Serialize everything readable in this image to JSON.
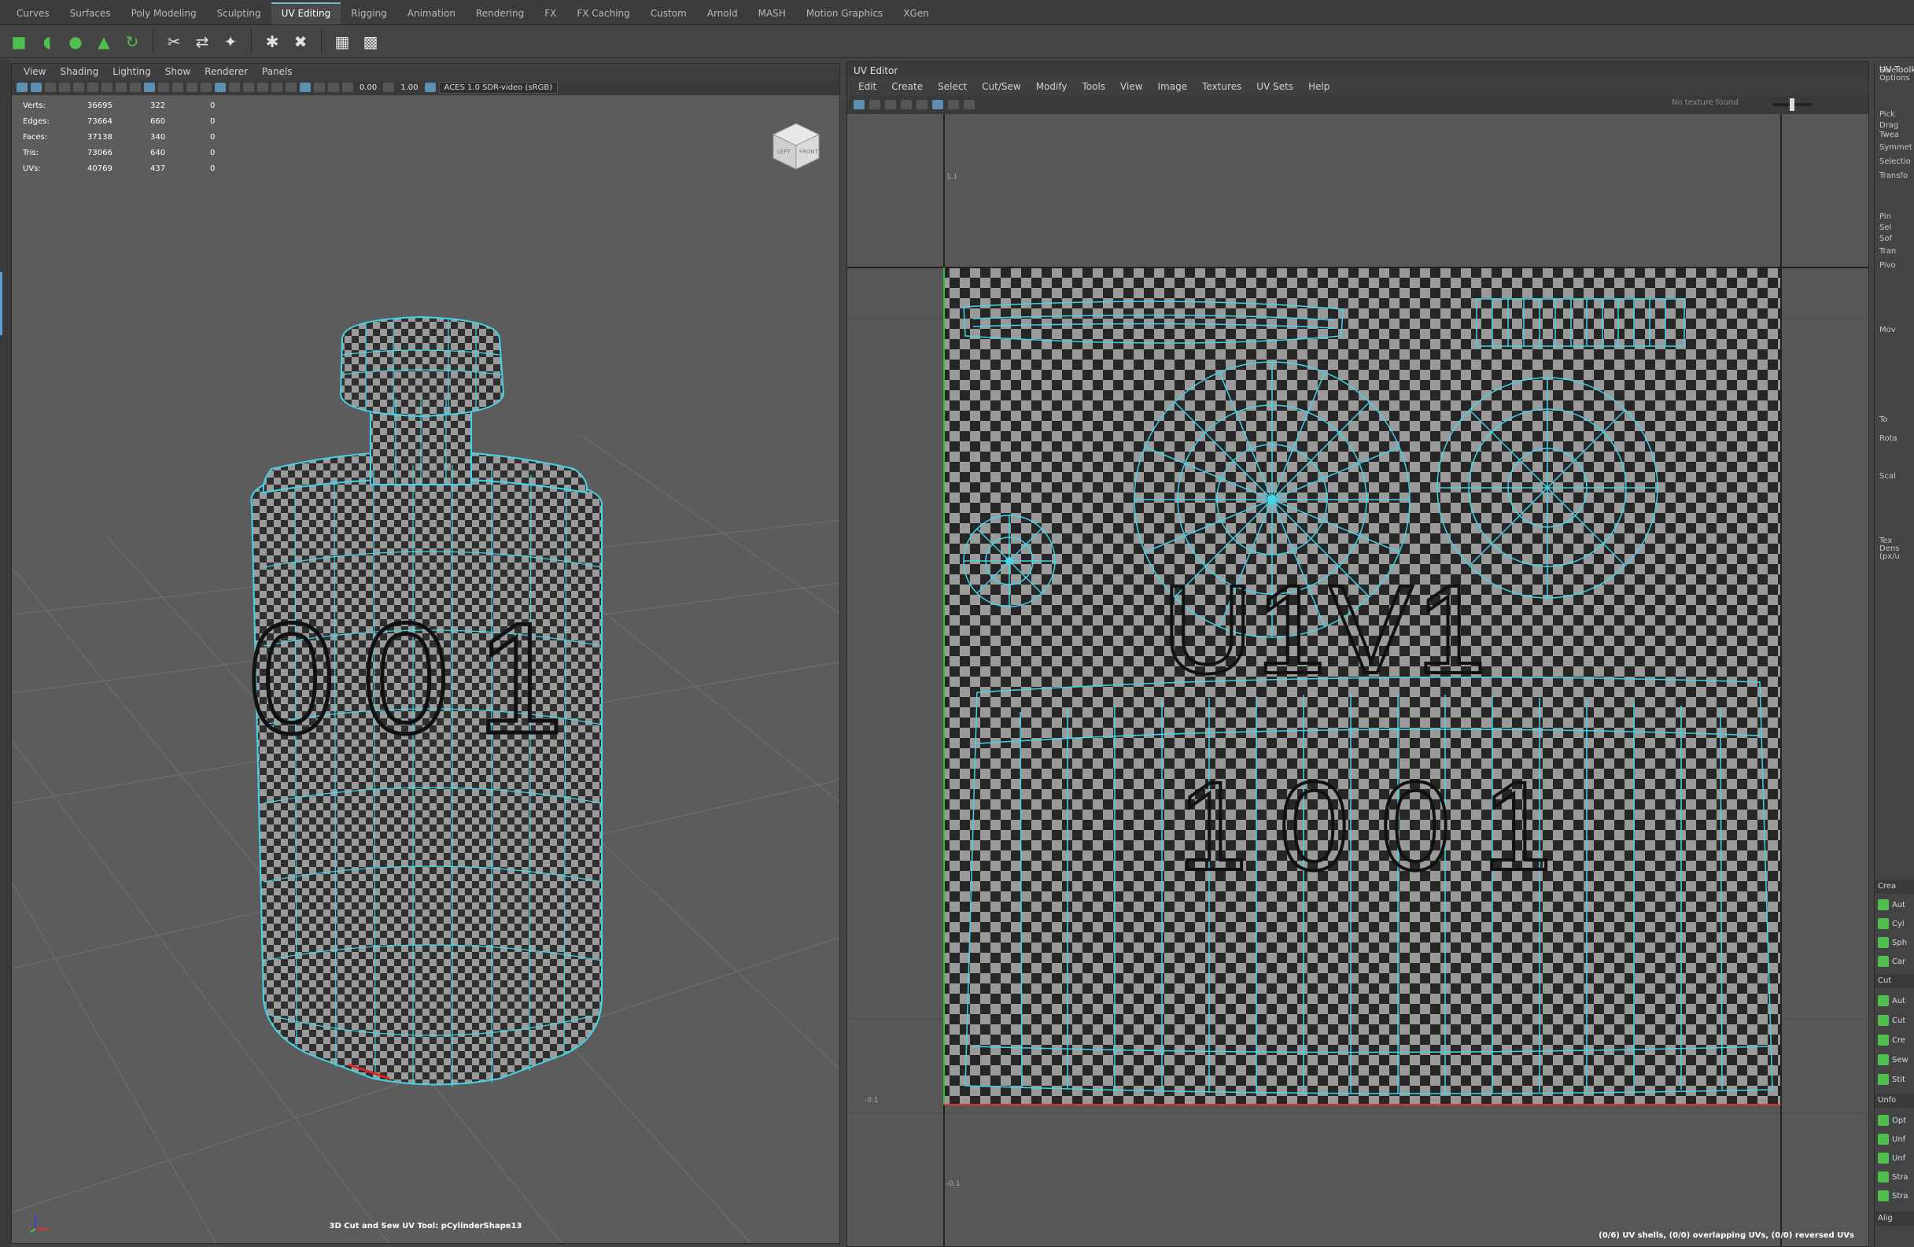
{
  "shelf": {
    "tabs": [
      "Curves",
      "Surfaces",
      "Poly Modeling",
      "Sculpting",
      "UV Editing",
      "Rigging",
      "Animation",
      "Rendering",
      "FX",
      "FX Caching",
      "Custom",
      "Arnold",
      "MASH",
      "Motion Graphics",
      "XGen"
    ],
    "active_tab": "UV Editing",
    "icons": [
      "planar-map-icon",
      "cylindrical-map-icon",
      "spherical-map-icon",
      "automatic-map-icon",
      "contour-stretch-icon",
      "cut-uvs-icon",
      "sew-uvs-icon",
      "create-uv-shell-icon",
      "unfold-icon",
      "optimize-icon",
      "checker-icon",
      "uv-editor-icon"
    ]
  },
  "viewport": {
    "menu": [
      "View",
      "Shading",
      "Lighting",
      "Show",
      "Renderer",
      "Panels"
    ],
    "toolbar": {
      "exposure": "0.00",
      "gamma": "1.00",
      "color_space": "ACES 1.0 SDR-video (sRGB)"
    },
    "hud": [
      {
        "label": "Verts:",
        "v1": "36695",
        "v2": "322",
        "v3": "0"
      },
      {
        "label": "Edges:",
        "v1": "73664",
        "v2": "660",
        "v3": "0"
      },
      {
        "label": "Faces:",
        "v1": "37138",
        "v2": "340",
        "v3": "0"
      },
      {
        "label": "Tris:",
        "v1": "73066",
        "v2": "640",
        "v3": "0"
      },
      {
        "label": "UVs:",
        "v1": "40769",
        "v2": "437",
        "v3": "0"
      }
    ],
    "viewcube": {
      "left": "LEFT",
      "front": "FRONT"
    },
    "mesh_text": "001",
    "status": "3D Cut and Sew UV Tool: pCylinderShape13"
  },
  "uv_editor": {
    "title": "UV Editor",
    "menu": [
      "Edit",
      "Create",
      "Select",
      "Cut/Sew",
      "Modify",
      "Tools",
      "View",
      "Image",
      "Textures",
      "UV Sets",
      "Help"
    ],
    "no_texture": "No texture found",
    "tile_label_1": "U1V1",
    "tile_label_2": "1001",
    "axis_labels": {
      "top": "1.1",
      "bottom": "-0.1",
      "lower": "-0.1"
    },
    "status": "(0/6) UV shells, (0/0) overlapping UVs, (0/0) reversed UVs"
  },
  "toolkit": {
    "title": "UV Toolkit",
    "options": "Options",
    "items": [
      "Sele",
      "Pick",
      "Drag",
      "Twea",
      "Symmet",
      "Selectio",
      "Transfo",
      "Pin",
      "Sel",
      "Sof",
      "Tran",
      "Pivo",
      "Mov",
      "To",
      "Rota",
      "Scal",
      "Tex",
      "Dens",
      "(px/u"
    ],
    "create_head": "Crea",
    "create_buttons": [
      "Aut",
      "Cyl",
      "Sph",
      "Car"
    ],
    "cut_head": "Cut",
    "cut_buttons": [
      "Aut",
      "Cut",
      "Cre",
      "Sew",
      "Stit"
    ],
    "unfold_head": "Unfo",
    "unfold_buttons": [
      "Opt",
      "Unf",
      "Unf",
      "Stra",
      "Stra"
    ],
    "align_head": "Alig"
  },
  "colors": {
    "wire": "#44d4e8",
    "checker_dark": "#2b2b2b",
    "checker_light": "#9a9a9a",
    "accent": "#5aa0d8",
    "shelf_green": "#4fbf4f"
  }
}
